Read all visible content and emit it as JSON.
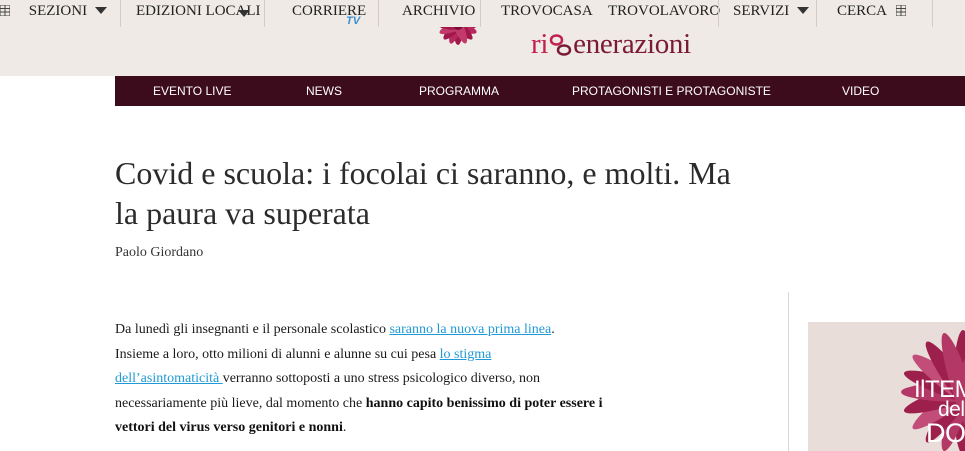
{
  "topnav": {
    "sezioni": "SEZIONI",
    "edizioni": "EDIZIONI LOCALI",
    "corriere": "CORRIERE",
    "corriere_badge": "TV",
    "archivio": "ARCHIVIO",
    "trovocasa": "TROVOCASA",
    "trovolavoro": "TROVOLAVORO",
    "servizi": "SERVIZI",
    "cerca": "CERCA"
  },
  "brand": {
    "part1": "ri",
    "part2": "enerazioni",
    "color": "#7b1a37",
    "accent": "#c2204a"
  },
  "secmenu": {
    "items": [
      "EVENTO LIVE",
      "NEWS",
      "PROGRAMMA",
      "PROTAGONISTI E PROTAGONISTE",
      "VIDEO"
    ],
    "background": "#3d0c1c"
  },
  "article": {
    "title_line1": "Covid e scuola: i focolai ci saranno, e molti. Ma",
    "title_line2": "la paura va superata",
    "author": "Paolo Giordano",
    "p1_a": "Da lunedì gli insegnanti e il personale scolastico ",
    "p1_link1": "saranno la nuova prima linea",
    "p1_b": ".",
    "p1_c": "Insieme a loro, otto milioni di alunni e alunne su cui pesa ",
    "p1_link2a": "lo stigma",
    "p1_link2b": "dell’asintomaticità ",
    "p1_d": "verranno sottoposti a uno stress psicologico diverso, non necessariamente più lieve, dal momento che ",
    "p1_bold": "hanno capito benissimo di poter essere i vettori del virus verso genitori e nonni",
    "p1_e": ".",
    "link_color": "#1f9ad6"
  },
  "promo": {
    "line1": "IlTEM",
    "line2": "del",
    "line3": "DON"
  }
}
